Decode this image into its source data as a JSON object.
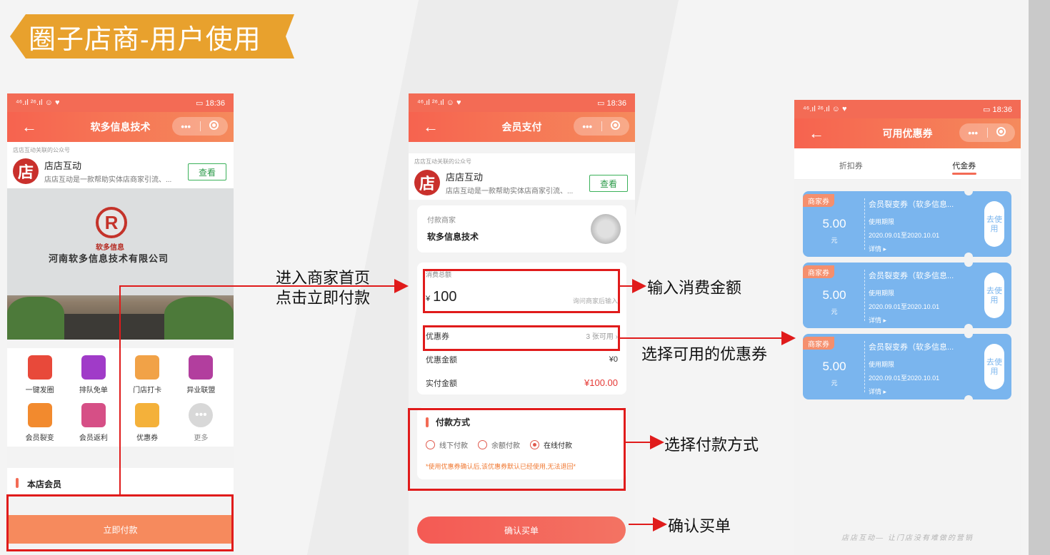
{
  "title": "圈子店商-用户使用",
  "status_bar": {
    "time": "18:36",
    "battery": "22"
  },
  "phone1": {
    "nav_title": "软多信息技术",
    "official_caption": "店店互动关联的公众号",
    "official_name": "店店互动",
    "official_desc": "店店互动是一款帮助实体店商家引流、...",
    "view_label": "查看",
    "logo_char": "店",
    "store_brand": "软多信息",
    "store_name": "河南软多信息技术有限公司",
    "grid": [
      {
        "label": "一键发圈",
        "color": "#e8493a"
      },
      {
        "label": "排队免单",
        "color": "#a03bc8"
      },
      {
        "label": "门店打卡",
        "color": "#f1a247"
      },
      {
        "label": "异业联盟",
        "color": "#b23e9e"
      },
      {
        "label": "会员裂变",
        "color": "#f28a2e"
      },
      {
        "label": "会员返利",
        "color": "#d64f86"
      },
      {
        "label": "优惠券",
        "color": "#f4b13a"
      },
      {
        "label": "更多",
        "color": "#d8d8d8"
      }
    ],
    "members_label": "本店会员",
    "pay_now_label": "立即付款"
  },
  "phone2": {
    "nav_title": "会员支付",
    "official_caption": "店店互动关联的公众号",
    "official_name": "店店互动",
    "official_desc": "店店互动是一款帮助实体店商家引流、...",
    "view_label": "查看",
    "logo_char": "店",
    "merchant_caption": "付款商家",
    "merchant_name": "软多信息技术",
    "amount_caption": "消费总额",
    "currency": "¥",
    "amount_value": "100",
    "amount_hint": "询问商家后输入",
    "coupon_label": "优惠券",
    "coupon_available": "3 张可用",
    "discount_label": "优惠金额",
    "discount_value": "¥0",
    "actual_label": "实付金额",
    "actual_value": "¥100.00",
    "pay_method_title": "付款方式",
    "pay_options": [
      "线下付款",
      "余额付款",
      "在线付款"
    ],
    "pay_note": "*使用优惠券确认后,该优惠券默认已经使用,无法退回*",
    "confirm_label": "确认买单"
  },
  "phone3": {
    "nav_title": "可用优惠券",
    "tabs": [
      "折扣券",
      "代金券"
    ],
    "coupons": [
      {
        "tag": "商家券",
        "amount": "5.00",
        "unit": "元",
        "title": "会员裂变券（软多信息...",
        "period_caption": "使用期限",
        "period": "2020.09.01至2020.10.01",
        "detail": "详情 ▸",
        "use_label": "去使用"
      },
      {
        "tag": "商家券",
        "amount": "5.00",
        "unit": "元",
        "title": "会员裂变券（软多信息...",
        "period_caption": "使用期限",
        "period": "2020.09.01至2020.10.01",
        "detail": "详情 ▸",
        "use_label": "去使用"
      },
      {
        "tag": "商家券",
        "amount": "5.00",
        "unit": "元",
        "title": "会员裂变券（软多信息...",
        "period_caption": "使用期限",
        "period": "2020.09.01至2020.10.01",
        "detail": "详情 ▸",
        "use_label": "去使用"
      }
    ],
    "slogan": "店店互动— 让门店没有难做的营销"
  },
  "annotations": {
    "enter_line1": "进入商家首页",
    "enter_line2": "点击立即付款",
    "input_amount": "输入消费金额",
    "choose_coupon": "选择可用的优惠券",
    "choose_payment": "选择付款方式",
    "confirm": "确认买单"
  },
  "colors": {
    "accent": "#f36b55",
    "banner": "#e8a12d",
    "highlight": "#e01b1b",
    "coupon": "#7ab5ee"
  }
}
